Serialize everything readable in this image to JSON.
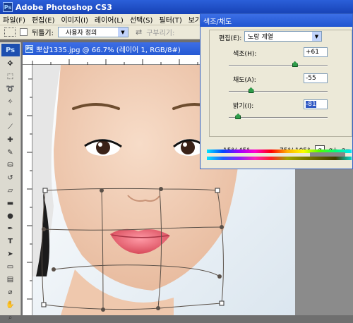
{
  "app": {
    "title": "Adobe Photoshop CS3",
    "badge": "Ps"
  },
  "menu": [
    "파일(F)",
    "편집(E)",
    "이미지(I)",
    "레이어(L)",
    "선택(S)",
    "필터(T)",
    "보기(V)"
  ],
  "options": {
    "check_label": "뒤틀기:",
    "select_value": "사용자 정의",
    "disabled_label": "구부리기:"
  },
  "document": {
    "title": "뽀샵1335.jpg @ 66.7% (레이어 1, RGB/8#)",
    "icon": "Ps"
  },
  "dialog": {
    "title": "색조/채도",
    "edit_label": "편집(E):",
    "edit_value": "노랑 계열",
    "hue": {
      "label": "색조(H):",
      "value": "+61",
      "min": -180,
      "max": 180
    },
    "saturation": {
      "label": "채도(A):",
      "value": "-55",
      "min": -100,
      "max": 100
    },
    "lightness": {
      "label": "밝기(I):",
      "value": "-81",
      "min": -100,
      "max": 100
    },
    "range_left": "15°/ 45°",
    "range_right": "75°/ 105°"
  },
  "icons": {
    "marquee": "marquee-icon",
    "move": "move-icon",
    "lasso": "lasso-icon",
    "crop": "crop-icon",
    "brush": "brush-icon",
    "stamp": "stamp-icon",
    "eraser": "eraser-icon",
    "gradient": "gradient-icon",
    "dodge": "dodge-icon",
    "pen": "pen-icon",
    "type": "type-icon",
    "path": "path-select-icon",
    "shape": "shape-icon",
    "eyedropper": "eyedropper-icon",
    "hand": "hand-icon",
    "zoom": "zoom-icon"
  },
  "colors": {
    "skin": "#f2d2bb",
    "lips": "#e2606c",
    "brow": "#6e4d2f",
    "warp_line": "#5a5048"
  }
}
